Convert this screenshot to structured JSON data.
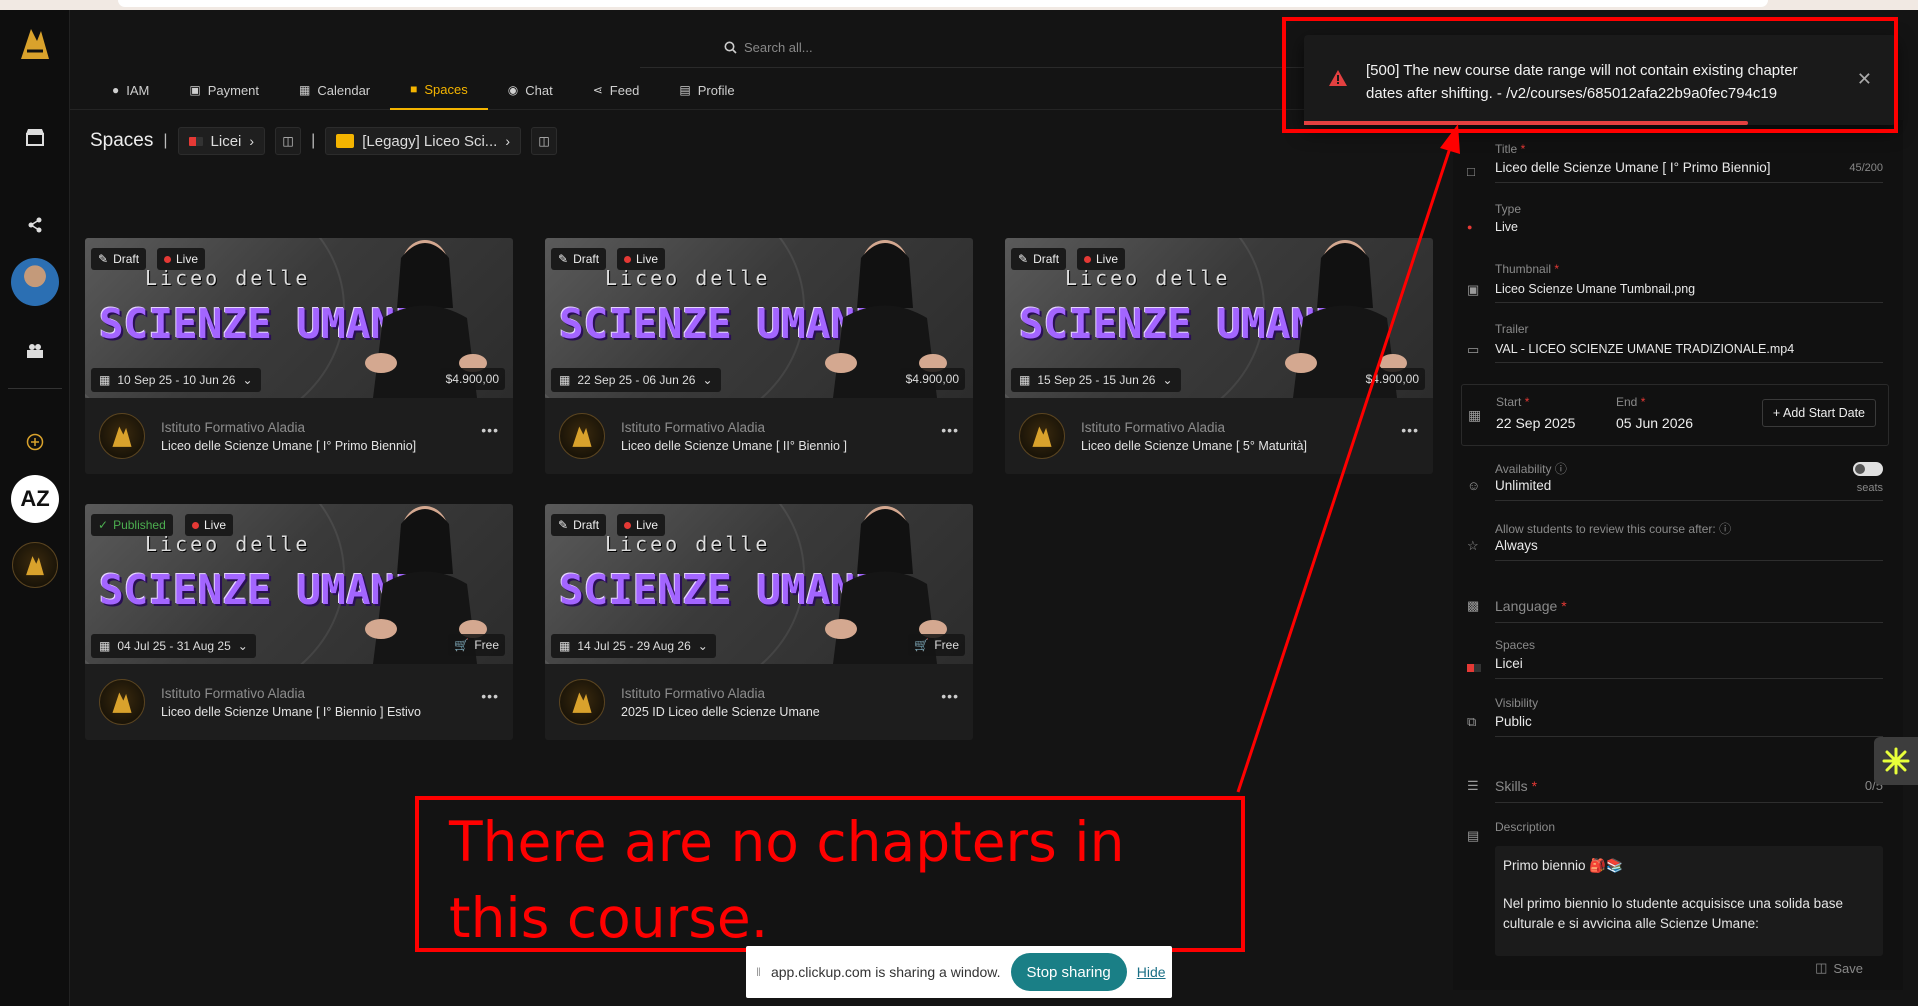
{
  "search": {
    "placeholder": "Search all..."
  },
  "tabs": [
    {
      "label": "IAM",
      "icon": "person-icon"
    },
    {
      "label": "Payment",
      "icon": "credit-card-icon"
    },
    {
      "label": "Calendar",
      "icon": "calendar-icon"
    },
    {
      "label": "Spaces",
      "icon": "cube-icon",
      "active": true
    },
    {
      "label": "Chat",
      "icon": "chat-icon"
    },
    {
      "label": "Feed",
      "icon": "share-icon"
    },
    {
      "label": "Profile",
      "icon": "id-card-icon"
    }
  ],
  "breadcrumb": {
    "title": "Spaces",
    "space": "Licei",
    "folder": "[Legagy] Liceo Sci..."
  },
  "cards": [
    {
      "status": "Draft",
      "mode": "Live",
      "dates": "10 Sep 25 - 10 Jun 26",
      "price": "$4.900,00",
      "org": "Istituto Formativo Aladia",
      "title": "Liceo delle Scienze Umane [ I° Primo Biennio]",
      "thumb_script": "Liceo delle",
      "thumb_big": "SCIENZE UMANE"
    },
    {
      "status": "Draft",
      "mode": "Live",
      "dates": "22 Sep 25 - 06 Jun 26",
      "price": "$4.900,00",
      "org": "Istituto Formativo Aladia",
      "title": "Liceo delle Scienze Umane [ II° Biennio ]",
      "thumb_script": "Liceo delle",
      "thumb_big": "SCIENZE UMANE"
    },
    {
      "status": "Draft",
      "mode": "Live",
      "dates": "15 Sep 25 - 15 Jun 26",
      "price": "$4.900,00",
      "org": "Istituto Formativo Aladia",
      "title": "Liceo delle Scienze Umane [ 5° Maturità]",
      "thumb_script": "Liceo delle",
      "thumb_big": "SCIENZE UMANE"
    },
    {
      "status": "Published",
      "mode": "Live",
      "dates": "04 Jul 25 - 31 Aug 25",
      "price": "Free",
      "org": "Istituto Formativo Aladia",
      "title": "Liceo delle Scienze Umane [ I° Biennio ] Estivo",
      "thumb_script": "Liceo delle",
      "thumb_big": "SCIENZE UMANE"
    },
    {
      "status": "Draft",
      "mode": "Live",
      "dates": "14 Jul 25 - 29 Aug 26",
      "price": "Free",
      "org": "Istituto Formativo Aladia",
      "title": "2025 ID Liceo delle Scienze Umane",
      "thumb_script": "Liceo delle",
      "thumb_big": "SCIENZE UMANE"
    }
  ],
  "panel": {
    "title_label": "Title",
    "title_value": "Liceo delle Scienze Umane [ I° Primo Biennio]",
    "title_count": "45/200",
    "type_label": "Type",
    "type_value": "Live",
    "thumbnail_label": "Thumbnail",
    "thumbnail_value": "Liceo Scienze Umane Tumbnail.png",
    "trailer_label": "Trailer",
    "trailer_value": "VAL - LICEO SCIENZE UMANE TRADIZIONALE.mp4",
    "start_label": "Start",
    "start_value": "22 Sep 2025",
    "end_label": "End",
    "end_value": "05 Jun 2026",
    "add_start_date": "+ Add Start Date",
    "availability_label": "Availability",
    "availability_value": "Unlimited",
    "seats_label": "seats",
    "review_label": "Allow students to review this course after:",
    "review_value": "Always",
    "language_label": "Language",
    "spaces_label": "Spaces",
    "spaces_value": "Licei",
    "visibility_label": "Visibility",
    "visibility_value": "Public",
    "skills_label": "Skills",
    "skills_count": "0/5",
    "description_label": "Description",
    "description_line1": "Primo biennio 🎒📚",
    "description_line2": "Nel primo biennio lo studente acquisisce una solida base culturale e si avvicina alle Scienze Umane:",
    "save_label": "Save"
  },
  "toast": {
    "message": "[500] The new course date range will not contain existing chapter dates after shifting. - /v2/courses/685012afa22b9a0fec794c19",
    "progress": 0.75
  },
  "annotation": {
    "text": "There are no chapters in this course."
  },
  "share_bar": {
    "text": "app.clickup.com is sharing a window.",
    "stop_label": "Stop sharing",
    "hide_label": "Hide"
  },
  "colors": {
    "accent": "#f4b400",
    "error": "#e34040",
    "annotation": "#ff0000",
    "purple_title": "#a365ff"
  }
}
